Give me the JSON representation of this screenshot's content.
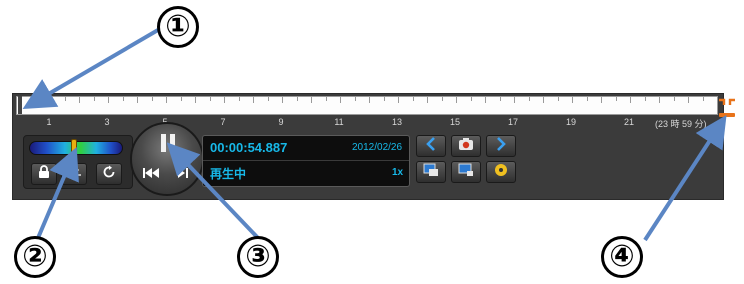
{
  "callouts": {
    "c1": "①",
    "c2": "②",
    "c3": "③",
    "c4": "④"
  },
  "timeline": {
    "hour_labels": [
      "1",
      "3",
      "5",
      "7",
      "9",
      "11",
      "13",
      "15",
      "17",
      "19",
      "21"
    ],
    "range_label": "(23 時 59 分)"
  },
  "info": {
    "time": "00:00:54.887",
    "date": "2012/02/26",
    "status": "再生中",
    "speed": "1x"
  },
  "icons": {
    "lock": "lock-icon",
    "swap": "swap-icon",
    "loop": "loop-icon",
    "pause": "pause-icon",
    "prev": "skip-to-start-icon",
    "next": "step-forward-icon",
    "left": "chevron-left-icon",
    "right": "chevron-right-icon",
    "camera": "camera-icon",
    "export": "export-icon",
    "window": "window-icon",
    "disc": "disc-icon",
    "expand": "expand-icon"
  },
  "colors": {
    "accent_text": "#17b8e8",
    "panel": "#3b3b3b",
    "arrow": "#5b86c4",
    "handle": "#e8731a"
  }
}
